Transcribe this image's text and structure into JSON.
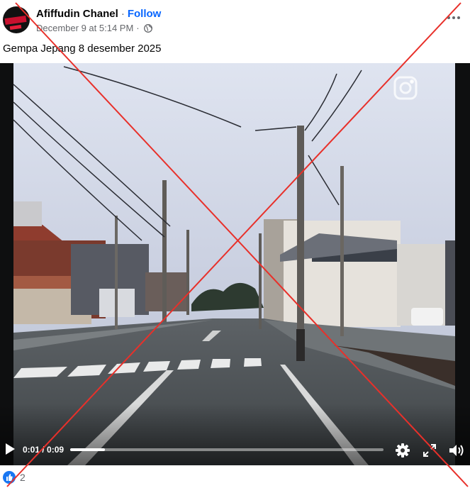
{
  "post": {
    "author": "Afiffudin Chanel",
    "separator": "·",
    "follow_label": "Follow",
    "timestamp": "December 9 at 5:14 PM",
    "privacy_icon": "globe-icon",
    "caption": "Gempa Jepang 8 desember 2025",
    "avatar_badge_text": "AFIFFUDIN CHANEL"
  },
  "video": {
    "time_display": "0:01 / 0:09",
    "progress_fraction": 0.11,
    "watermark_icon": "instagram-icon",
    "controls": [
      "play-icon",
      "settings-gear-icon",
      "fullscreen-icon",
      "volume-icon"
    ]
  },
  "reactions": {
    "icon": "like-icon",
    "count": "2"
  },
  "overlay": {
    "mark": "red-x",
    "color": "#e8302a"
  },
  "colors": {
    "link_blue": "#0866ff",
    "secondary_text": "#65676b",
    "like_blue": "#1877f2"
  }
}
